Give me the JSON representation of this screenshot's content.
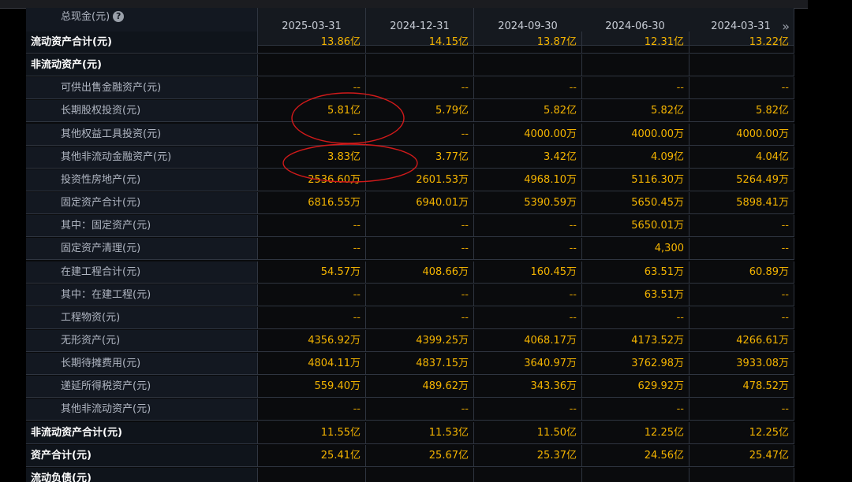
{
  "table": {
    "top_label": "总现金(元)",
    "dates": [
      "2025-03-31",
      "2024-12-31",
      "2024-09-30",
      "2024-06-30",
      "2024-03-31"
    ],
    "rows": [
      {
        "label": "流动资产合计(元)",
        "bold": true,
        "values": [
          "13.86亿",
          "14.15亿",
          "13.87亿",
          "12.31亿",
          "13.22亿"
        ]
      },
      {
        "label": "非流动资产(元)",
        "bold": true,
        "values": [
          "",
          "",
          "",
          "",
          ""
        ]
      },
      {
        "label": "可供出售金融资产(元)",
        "bold": false,
        "values": [
          "--",
          "--",
          "--",
          "--",
          "--"
        ]
      },
      {
        "label": "长期股权投资(元)",
        "bold": false,
        "values": [
          "5.81亿",
          "5.79亿",
          "5.82亿",
          "5.82亿",
          "5.82亿"
        ]
      },
      {
        "label": "其他权益工具投资(元)",
        "bold": false,
        "values": [
          "--",
          "--",
          "4000.00万",
          "4000.00万",
          "4000.00万"
        ]
      },
      {
        "label": "其他非流动金融资产(元)",
        "bold": false,
        "values": [
          "3.83亿",
          "3.77亿",
          "3.42亿",
          "4.09亿",
          "4.04亿"
        ]
      },
      {
        "label": "投资性房地产(元)",
        "bold": false,
        "values": [
          "2536.60万",
          "2601.53万",
          "4968.10万",
          "5116.30万",
          "5264.49万"
        ]
      },
      {
        "label": "固定资产合计(元)",
        "bold": false,
        "values": [
          "6816.55万",
          "6940.01万",
          "5390.59万",
          "5650.45万",
          "5898.41万"
        ]
      },
      {
        "label": "其中：固定资产(元)",
        "bold": false,
        "values": [
          "--",
          "--",
          "--",
          "5650.01万",
          "--"
        ]
      },
      {
        "label": "固定资产清理(元)",
        "bold": false,
        "values": [
          "--",
          "--",
          "--",
          "4,300",
          "--"
        ]
      },
      {
        "label": "在建工程合计(元)",
        "bold": false,
        "values": [
          "54.57万",
          "408.66万",
          "160.45万",
          "63.51万",
          "60.89万"
        ]
      },
      {
        "label": "其中：在建工程(元)",
        "bold": false,
        "values": [
          "--",
          "--",
          "--",
          "63.51万",
          "--"
        ]
      },
      {
        "label": "工程物资(元)",
        "bold": false,
        "values": [
          "--",
          "--",
          "--",
          "--",
          "--"
        ]
      },
      {
        "label": "无形资产(元)",
        "bold": false,
        "values": [
          "4356.92万",
          "4399.25万",
          "4068.17万",
          "4173.52万",
          "4266.61万"
        ]
      },
      {
        "label": "长期待摊费用(元)",
        "bold": false,
        "values": [
          "4804.11万",
          "4837.15万",
          "3640.97万",
          "3762.98万",
          "3933.08万"
        ]
      },
      {
        "label": "递延所得税资产(元)",
        "bold": false,
        "values": [
          "559.40万",
          "489.62万",
          "343.36万",
          "629.92万",
          "478.52万"
        ]
      },
      {
        "label": "其他非流动资产(元)",
        "bold": false,
        "values": [
          "--",
          "--",
          "--",
          "--",
          "--"
        ]
      },
      {
        "label": "非流动资产合计(元)",
        "bold": true,
        "values": [
          "11.55亿",
          "11.53亿",
          "11.50亿",
          "12.25亿",
          "12.25亿"
        ]
      },
      {
        "label": "资产合计(元)",
        "bold": true,
        "values": [
          "25.41亿",
          "25.67亿",
          "25.37亿",
          "24.56亿",
          "25.47亿"
        ]
      },
      {
        "label": "流动负债(元)",
        "bold": true,
        "values": [
          "",
          "",
          "",
          "",
          ""
        ]
      }
    ],
    "more_icon": "double-chevron-right-icon"
  },
  "colors": {
    "value": "#f4b400",
    "label": "#b0b6c2",
    "annotation": "#d11a1a"
  }
}
